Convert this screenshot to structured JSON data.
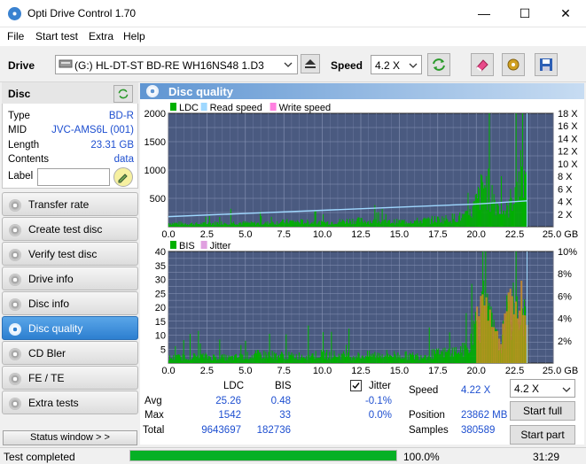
{
  "window": {
    "title": "Opti Drive Control 1.70",
    "min": "—",
    "max": "☐",
    "close": "✕"
  },
  "menu": [
    {
      "label": "File"
    },
    {
      "label": "Start test"
    },
    {
      "label": "Extra"
    },
    {
      "label": "Help"
    }
  ],
  "toolbar": {
    "drive_label": "Drive",
    "drive_value": "(G:)  HL-DT-ST BD-RE  WH16NS48 1.D3",
    "speed_label": "Speed",
    "speed_value": "4.2 X"
  },
  "disc": {
    "title": "Disc",
    "rows": [
      {
        "key": "Type",
        "value": "BD-R"
      },
      {
        "key": "MID",
        "value": "JVC-AMS6L (001)"
      },
      {
        "key": "Length",
        "value": "23.31 GB"
      },
      {
        "key": "Contents",
        "value": "data"
      }
    ],
    "label_key": "Label",
    "label_value": ""
  },
  "nav": [
    {
      "label": "Transfer rate"
    },
    {
      "label": "Create test disc"
    },
    {
      "label": "Verify test disc"
    },
    {
      "label": "Drive info"
    },
    {
      "label": "Disc info"
    },
    {
      "label": "Disc quality"
    },
    {
      "label": "CD Bler"
    },
    {
      "label": "FE / TE"
    },
    {
      "label": "Extra tests"
    }
  ],
  "status_window_label": "Status window > >",
  "panel": {
    "title": "Disc quality"
  },
  "colors": {
    "ldc": "#00b000",
    "read_speed": "#9fd8ff",
    "write_speed": "#ff80e0",
    "bis": "#00b000",
    "jitter": "#e0a0e0",
    "plot_bg": "#4a5a80",
    "accent": "#2d7fd0"
  },
  "chart_data": [
    {
      "type": "bar",
      "legend": [
        "LDC",
        "Read speed",
        "Write speed"
      ],
      "x_ticks": [
        "0.0",
        "2.5",
        "5.0",
        "7.5",
        "10.0",
        "12.5",
        "15.0",
        "17.5",
        "20.0",
        "22.5",
        "25.0 GB"
      ],
      "y_ticks": [
        "2000",
        "1500",
        "1000",
        "500"
      ],
      "y2_ticks": [
        "18 X",
        "16 X",
        "14 X",
        "12 X",
        "10 X",
        "8 X",
        "6 X",
        "4 X",
        "2 X"
      ],
      "xlim": [
        0,
        25
      ],
      "ylim": [
        0,
        2000
      ],
      "y2lim": [
        0,
        18
      ],
      "ldc_envelope": [
        [
          0,
          100
        ],
        [
          2,
          80
        ],
        [
          4,
          120
        ],
        [
          6,
          90
        ],
        [
          8,
          150
        ],
        [
          10,
          110
        ],
        [
          12,
          180
        ],
        [
          14,
          130
        ],
        [
          16,
          160
        ],
        [
          18,
          220
        ],
        [
          19.5,
          300
        ],
        [
          20,
          700
        ],
        [
          20.5,
          1200
        ],
        [
          21,
          900
        ],
        [
          21.5,
          500
        ],
        [
          22,
          450
        ],
        [
          22.5,
          1100
        ],
        [
          23,
          1542
        ],
        [
          23.3,
          800
        ]
      ],
      "read_speed": [
        [
          0,
          1.6
        ],
        [
          5,
          2.1
        ],
        [
          10,
          2.6
        ],
        [
          15,
          3.1
        ],
        [
          20,
          3.6
        ],
        [
          23.3,
          4.1
        ]
      ]
    },
    {
      "type": "bar",
      "legend": [
        "BIS",
        "Jitter"
      ],
      "x_ticks": [
        "0.0",
        "2.5",
        "5.0",
        "7.5",
        "10.0",
        "12.5",
        "15.0",
        "17.5",
        "20.0",
        "22.5",
        "25.0 GB"
      ],
      "y_ticks": [
        "40",
        "35",
        "30",
        "25",
        "20",
        "15",
        "10",
        "5"
      ],
      "y2_ticks": [
        "10%",
        "8%",
        "6%",
        "4%",
        "2%"
      ],
      "xlim": [
        0,
        25
      ],
      "ylim": [
        0,
        40
      ],
      "y2lim": [
        0,
        10
      ],
      "bis_envelope": [
        [
          0,
          3
        ],
        [
          2,
          4
        ],
        [
          4,
          3
        ],
        [
          6,
          5
        ],
        [
          8,
          4
        ],
        [
          10,
          5
        ],
        [
          12,
          4
        ],
        [
          14,
          5
        ],
        [
          16,
          4
        ],
        [
          18,
          6
        ],
        [
          19.5,
          8
        ],
        [
          20,
          25
        ],
        [
          20.5,
          30
        ],
        [
          21,
          20
        ],
        [
          21.5,
          8
        ],
        [
          22,
          26
        ],
        [
          22.5,
          30
        ],
        [
          23,
          33
        ],
        [
          23.3,
          15
        ]
      ]
    }
  ],
  "stats": {
    "headers": [
      "LDC",
      "BIS"
    ],
    "jitter_label": "Jitter",
    "jitter_checked": true,
    "rows": [
      {
        "label": "Avg",
        "ldc": "25.26",
        "bis": "0.48",
        "jitter": "-0.1%"
      },
      {
        "label": "Max",
        "ldc": "1542",
        "bis": "33",
        "jitter": "0.0%"
      },
      {
        "label": "Total",
        "ldc": "9643697",
        "bis": "182736",
        "jitter": ""
      }
    ],
    "speed_label": "Speed",
    "speed_value": "4.22 X",
    "position_label": "Position",
    "position_value": "23862 MB",
    "samples_label": "Samples",
    "samples_value": "380589",
    "speed_select": "4.2 X",
    "start_full": "Start full",
    "start_part": "Start part"
  },
  "status": {
    "text": "Test completed",
    "progress": 1.0,
    "progress_text": "100.0%",
    "time": "31:29"
  }
}
